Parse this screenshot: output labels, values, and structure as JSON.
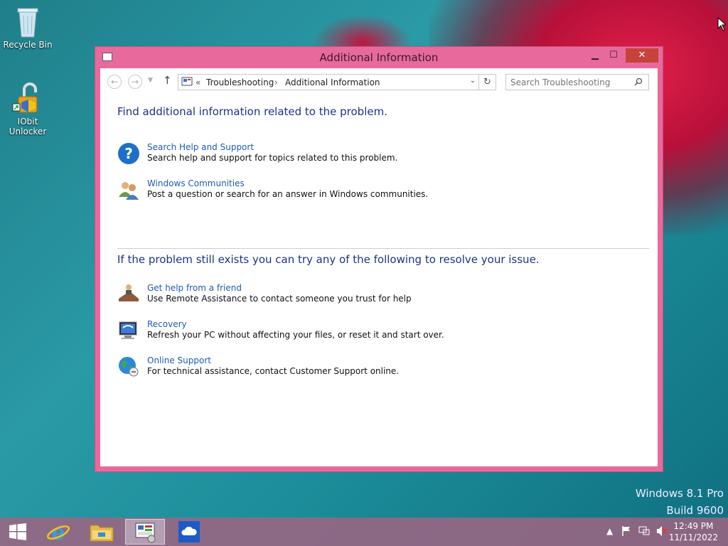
{
  "desktop": {
    "icons": [
      {
        "label": "Recycle Bin",
        "icon": "recycle-bin-icon"
      },
      {
        "label": "IObit Unlocker",
        "icon": "iobit-unlocker-icon"
      }
    ],
    "watermark_line1": "Windows 8.1 Pro",
    "watermark_line2": "Build 9600"
  },
  "window": {
    "title": "Additional Information",
    "controls": {
      "minimize": "▁",
      "maximize": "☐",
      "close": "✕"
    },
    "address": {
      "chevron": "«",
      "crumb1": "Troubleshooting",
      "crumb2": "Additional Information",
      "separator": "›"
    },
    "search": {
      "placeholder": "Search Troubleshooting"
    },
    "section1": {
      "heading": "Find additional information related to the problem.",
      "items": [
        {
          "title": "Search Help and Support",
          "desc": "Search help and support for topics related to this problem.",
          "icon": "help-question-icon"
        },
        {
          "title": "Windows Communities",
          "desc": "Post a question or search for an answer in Windows communities.",
          "icon": "communities-people-icon"
        }
      ]
    },
    "section2": {
      "heading": "If the problem still exists you can try any of the following to resolve your issue.",
      "items": [
        {
          "title": "Get help from a friend",
          "desc": "Use Remote Assistance to contact someone you trust for help",
          "icon": "remote-assistance-icon"
        },
        {
          "title": "Recovery",
          "desc": "Refresh your PC without affecting your files, or reset it and start over.",
          "icon": "recovery-monitor-icon"
        },
        {
          "title": "Online Support",
          "desc": "For technical assistance, contact Customer Support online.",
          "icon": "online-support-globe-icon"
        }
      ]
    }
  },
  "taskbar": {
    "time": "12:49 PM",
    "date": "11/11/2022"
  },
  "colors": {
    "window_frame": "#e86a9c",
    "link": "#1e5bb8",
    "heading": "#1e3287",
    "close_button": "#c7423a"
  }
}
